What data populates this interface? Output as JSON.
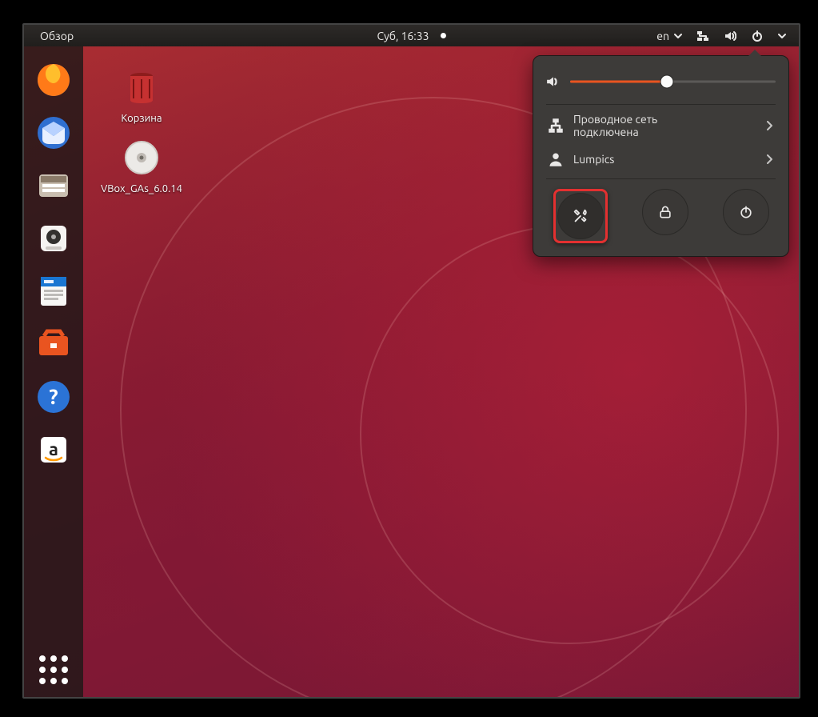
{
  "topbar": {
    "activities_label": "Обзор",
    "clock": "Суб, 16:33",
    "input_lang": "en"
  },
  "desktop": {
    "trash_label": "Корзина",
    "disc_label": "VBox_GAs_6.0.14"
  },
  "dock": {
    "items": [
      {
        "name": "firefox",
        "tooltip": "Firefox"
      },
      {
        "name": "thunderbird",
        "tooltip": "Thunderbird"
      },
      {
        "name": "files",
        "tooltip": "Files"
      },
      {
        "name": "rhythmbox",
        "tooltip": "Rhythmbox"
      },
      {
        "name": "writer",
        "tooltip": "LibreOffice Writer"
      },
      {
        "name": "software",
        "tooltip": "Ubuntu Software"
      },
      {
        "name": "help",
        "tooltip": "Help"
      },
      {
        "name": "amazon",
        "tooltip": "Amazon"
      }
    ]
  },
  "system_menu": {
    "volume_percent": 47,
    "network": {
      "line1": "Проводное сеть",
      "line2": "подключена"
    },
    "user_label": "Lumpics"
  },
  "colors": {
    "accent": "#e95420",
    "menu_bg": "#3d3b39",
    "highlight_red": "#e33030"
  }
}
